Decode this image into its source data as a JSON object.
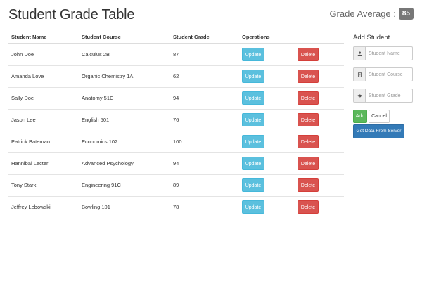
{
  "header": {
    "title": "Student Grade Table",
    "average_label": "Grade Average :",
    "average_value": "85"
  },
  "table": {
    "headers": [
      "Student Name",
      "Student Course",
      "Student Grade",
      "Operations"
    ],
    "rows": [
      {
        "name": "John Doe",
        "course": "Calculus 2B",
        "grade": "87"
      },
      {
        "name": "Amanda Love",
        "course": "Organic Chemistry 1A",
        "grade": "62"
      },
      {
        "name": "Sally Doe",
        "course": "Anatomy 51C",
        "grade": "94"
      },
      {
        "name": "Jason Lee",
        "course": "English 501",
        "grade": "76"
      },
      {
        "name": "Patrick Bateman",
        "course": "Economics 102",
        "grade": "100"
      },
      {
        "name": "Hannibal Lecter",
        "course": "Advanced Psychology",
        "grade": "94"
      },
      {
        "name": "Tony Stark",
        "course": "Engineering 91C",
        "grade": "89"
      },
      {
        "name": "Jeffrey Lebowski",
        "course": "Bowling 101",
        "grade": "78"
      }
    ],
    "update_label": "Update",
    "delete_label": "Delete"
  },
  "form": {
    "title": "Add Student",
    "name_placeholder": "Student Name",
    "course_placeholder": "Student Course",
    "grade_placeholder": "Student Grade",
    "add_label": "Add",
    "cancel_label": "Cancel",
    "server_label": "Get Data From Server",
    "icons": [
      "user-icon",
      "book-icon",
      "graduation-cap-icon"
    ]
  },
  "colors": {
    "update": "#5bc0de",
    "delete": "#d9534f",
    "add": "#5cb85c",
    "server": "#337ab7",
    "badge": "#777777"
  }
}
